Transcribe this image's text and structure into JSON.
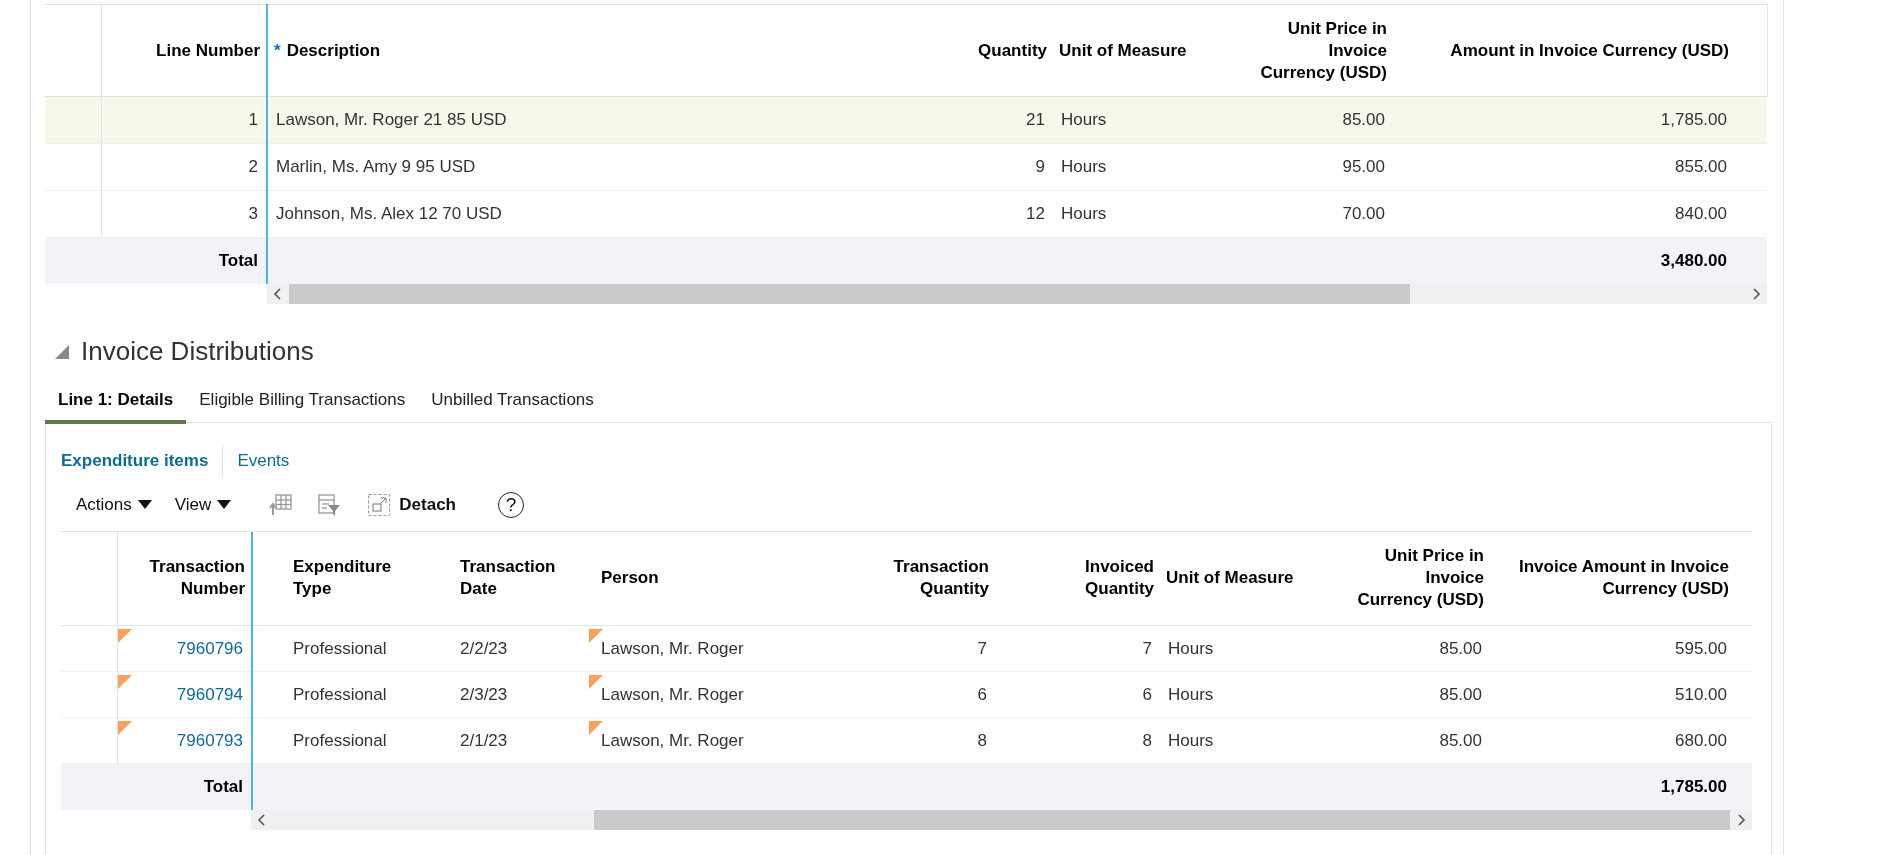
{
  "lines_table": {
    "columns": [
      {
        "label": "Line Number"
      },
      {
        "label": "Description",
        "required_mark": "*"
      },
      {
        "label": "Quantity"
      },
      {
        "label": "Unit of Measure"
      },
      {
        "label": "Unit Price in Invoice Currency (USD)"
      },
      {
        "label": "Amount in Invoice Currency (USD)"
      }
    ],
    "rows": [
      {
        "selected": true,
        "cells": [
          "1",
          "Lawson, Mr. Roger 21 85 USD",
          "21",
          "Hours",
          "85.00",
          "1,785.00"
        ]
      },
      {
        "selected": false,
        "cells": [
          "2",
          "Marlin, Ms. Amy 9 95 USD",
          "9",
          "Hours",
          "95.00",
          "855.00"
        ]
      },
      {
        "selected": false,
        "cells": [
          "3",
          "Johnson, Ms. Alex 12 70 USD",
          "12",
          "Hours",
          "70.00",
          "840.00"
        ]
      }
    ],
    "total_label": "Total",
    "total": "3,480.00"
  },
  "distributions": {
    "title": "Invoice Distributions",
    "expanded": true,
    "tabs": [
      {
        "label": "Line 1: Details",
        "selected": true
      },
      {
        "label": "Eligible Billing Transactions",
        "selected": false
      },
      {
        "label": "Unbilled Transactions",
        "selected": false
      }
    ],
    "subtabs": [
      {
        "label": "Expenditure items",
        "selected": true
      },
      {
        "label": "Events",
        "selected": false
      }
    ],
    "toolbar": {
      "menus": [
        "Actions",
        "View"
      ],
      "detach": "Detach",
      "help": "?"
    },
    "table": {
      "columns": [
        {
          "label": "Transaction Number"
        },
        {
          "label": "Expenditure Type"
        },
        {
          "label": "Transaction Date"
        },
        {
          "label": "Person"
        },
        {
          "label": "Transaction Quantity"
        },
        {
          "label": "Invoiced Quantity"
        },
        {
          "label": "Unit of Measure"
        },
        {
          "label": "Unit Price in Invoice Currency (USD)"
        },
        {
          "label": "Invoice Amount in Invoice Currency (USD)"
        }
      ],
      "rows": [
        {
          "flagged": true,
          "cells": [
            "7960796",
            "Professional",
            "2/2/23",
            "Lawson, Mr. Roger",
            "7",
            "7",
            "Hours",
            "85.00",
            "595.00"
          ]
        },
        {
          "flagged": true,
          "cells": [
            "7960794",
            "Professional",
            "2/3/23",
            "Lawson, Mr. Roger",
            "6",
            "6",
            "Hours",
            "85.00",
            "510.00"
          ]
        },
        {
          "flagged": true,
          "cells": [
            "7960793",
            "Professional",
            "2/1/23",
            "Lawson, Mr. Roger",
            "8",
            "8",
            "Hours",
            "85.00",
            "680.00"
          ]
        }
      ],
      "total_label": "Total",
      "total": "1,785.00"
    }
  }
}
